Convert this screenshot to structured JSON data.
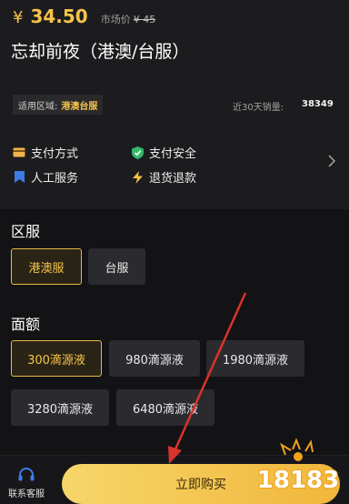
{
  "price": {
    "symbol": "¥",
    "value": "34.50",
    "market_label": "市场价",
    "market_value": "¥ 45"
  },
  "title": "忘却前夜（港澳/台服）",
  "region": {
    "label": "适用区域:",
    "value": "港澳台服"
  },
  "sales": {
    "label": "近30天销量:",
    "value": "38349"
  },
  "services": [
    {
      "label": "支付方式",
      "icon": "card-icon"
    },
    {
      "label": "支付安全",
      "icon": "shield-check-icon"
    },
    {
      "label": "人工服务",
      "icon": "bookmark-icon"
    },
    {
      "label": "退货退款",
      "icon": "lightning-icon"
    }
  ],
  "server": {
    "title": "区服",
    "options": [
      "港澳服",
      "台服"
    ],
    "selected": "港澳服"
  },
  "denomination": {
    "title": "面额",
    "options": [
      "300滴源液",
      "980滴源液",
      "1980滴源液",
      "3280滴源液",
      "6480滴源液"
    ],
    "selected": "300滴源液"
  },
  "bottom": {
    "customer_service": "联系客服",
    "buy_label": "立即购买"
  },
  "watermark_text": "18183",
  "colors": {
    "accent": "#f5c34a",
    "background": "#131315",
    "card": "#1c1c1f",
    "annotation_arrow": "#d9332b"
  }
}
